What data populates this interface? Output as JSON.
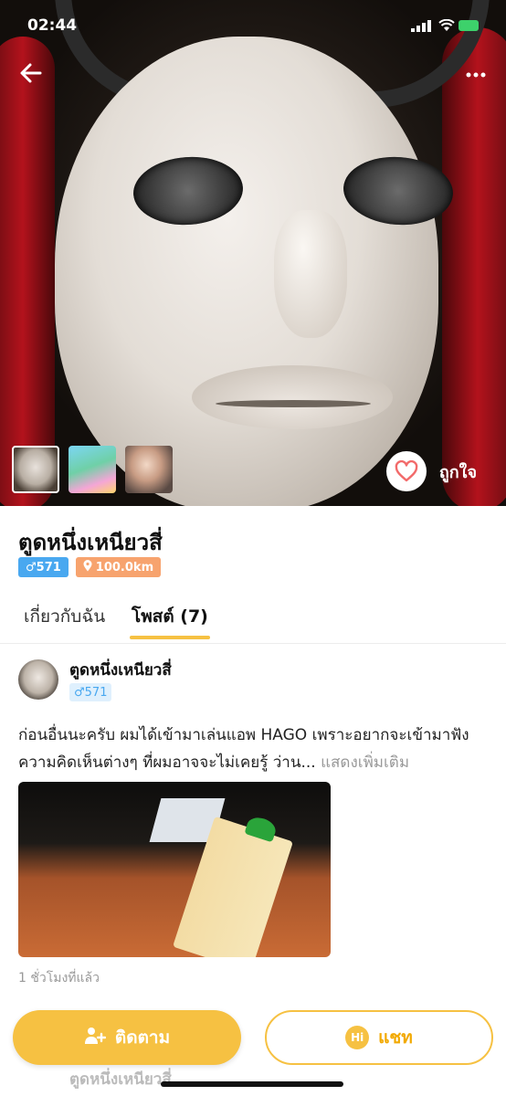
{
  "status_bar": {
    "time": "02:44"
  },
  "hero": {
    "like_label": "ถูกใจ"
  },
  "profile": {
    "name": "ตูดหนึ่งเหนียวสี่",
    "gender_badge": "♂571",
    "distance_badge": "100.0km"
  },
  "tabs": [
    {
      "label": "เกี่ยวกับฉัน"
    },
    {
      "label": "โพสต์ (7)"
    }
  ],
  "post": {
    "author": "ตูดหนึ่งเหนียวสี่",
    "badge": "♂571",
    "text": "ก่อนอื่นนะครับ ผมได้เข้ามาเล่นแอพ HAGO เพราะอยากจะเข้ามาฟังความคิดเห็นต่างๆ ที่ผมอาจจะไม่เคยรู้ ว่าน...",
    "see_more": "แสดงเพิ่มเติม",
    "time": "1 ชั่วโมงที่แล้ว"
  },
  "bottom": {
    "follow_label": "ติดตาม",
    "chat_icon": "Hi",
    "chat_label": "แชท",
    "next_post_author": "ตูดหนึ่งเหนียวสี่"
  },
  "colors": {
    "accent": "#f6c142",
    "male_badge": "#49a8f0",
    "distance_badge": "#f7a36e"
  }
}
